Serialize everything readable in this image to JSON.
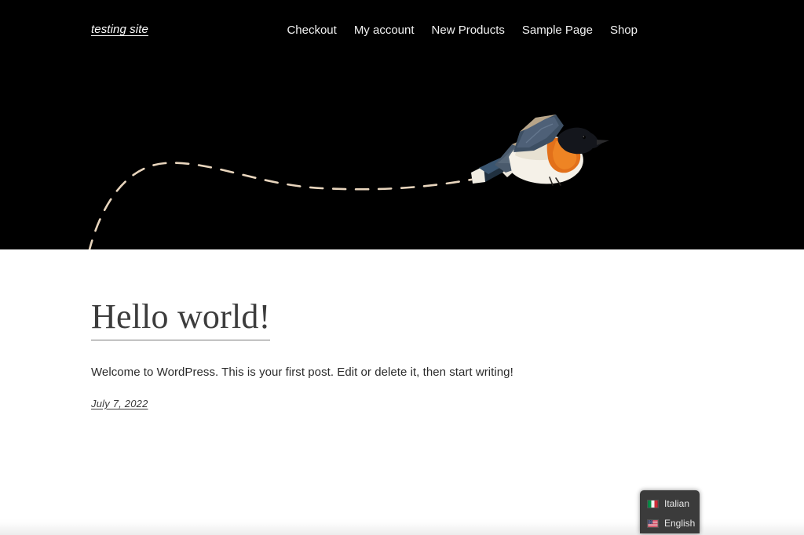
{
  "site": {
    "title": "testing site"
  },
  "nav": {
    "items": [
      {
        "label": "Checkout"
      },
      {
        "label": "My account"
      },
      {
        "label": "New Products"
      },
      {
        "label": "Sample Page"
      },
      {
        "label": "Shop"
      }
    ]
  },
  "hero": {
    "illustration": "flying-bird-with-dashed-trail",
    "background_color": "#000000",
    "trail_color": "#e8d5bd",
    "bird": {
      "head_color": "#14161c",
      "breast_color": "#e2701a",
      "belly_color": "#f3efe7",
      "wing_color": "#46566a",
      "wing_edge_color": "#b9a58a",
      "tail_color": "#1d2b3f"
    }
  },
  "post": {
    "title": "Hello world!",
    "body": "Welcome to WordPress. This is your first post. Edit or delete it, then start writing!",
    "date": "July 7, 2022"
  },
  "language_switcher": {
    "items": [
      {
        "label": "Italian",
        "flag": "flag-italy-icon"
      },
      {
        "label": "English",
        "flag": "flag-usa-icon"
      }
    ],
    "background_color": "#3b3b3b"
  }
}
